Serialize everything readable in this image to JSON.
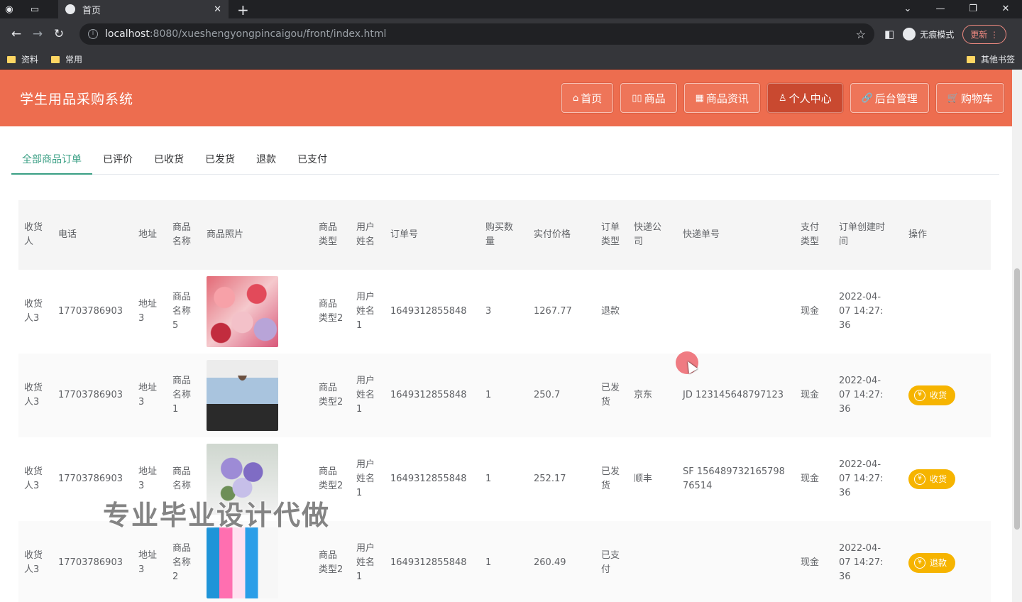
{
  "browser": {
    "tab_title": "首页",
    "url_host": "localhost",
    "url_path": ":8080/xueshengyongpincaigou/front/index.html",
    "incognito_label": "无痕模式",
    "update_label": "更新",
    "bookmarks": [
      "资料",
      "常用"
    ],
    "other_bookmarks": "其他书签"
  },
  "header": {
    "site_title": "学生用品采购系统",
    "nav": [
      {
        "icon": "⌂",
        "label": "首页"
      },
      {
        "icon": "▯▯",
        "label": "商品"
      },
      {
        "icon": "▦",
        "label": "商品资讯"
      },
      {
        "icon": "♙",
        "label": "个人中心"
      },
      {
        "icon": "🔗",
        "label": "后台管理"
      },
      {
        "icon": "🛒",
        "label": "购物车"
      }
    ],
    "active_nav": "个人中心"
  },
  "order_tabs": [
    "全部商品订单",
    "已评价",
    "已收货",
    "已发货",
    "退款",
    "已支付"
  ],
  "active_tab": "全部商品订单",
  "table": {
    "columns": [
      "收货人",
      "电话",
      "地址",
      "商品名称",
      "商品照片",
      "商品类型",
      "用户姓名",
      "订单号",
      "购买数量",
      "实付价格",
      "订单类型",
      "快递公司",
      "快递单号",
      "支付类型",
      "订单创建时间",
      "操作"
    ],
    "rows": [
      {
        "receiver": "收货人3",
        "phone": "17703786903",
        "address": "地址3",
        "product_name": "商品名称5",
        "photo": "roses",
        "product_type": "商品类型2",
        "user_name": "用户姓名1",
        "order_no": "1649312855848",
        "quantity": "3",
        "price": "1267.77",
        "order_type": "退款",
        "courier": "",
        "tracking_no": "",
        "pay_type": "现金",
        "created": "2022-04-07 14:27:36",
        "action": ""
      },
      {
        "receiver": "收货人3",
        "phone": "17703786903",
        "address": "地址3",
        "product_name": "商品名称1",
        "photo": "shirt",
        "product_type": "商品类型2",
        "user_name": "用户姓名1",
        "order_no": "1649312855848",
        "quantity": "1",
        "price": "250.7",
        "order_type": "已发货",
        "courier": "京东",
        "tracking_no": "JD 123145648797123",
        "pay_type": "现金",
        "created": "2022-04-07 14:27:36",
        "action": "收货"
      },
      {
        "receiver": "收货人3",
        "phone": "17703786903",
        "address": "地址3",
        "product_name": "商品名称",
        "photo": "bouquet",
        "product_type": "商品类型2",
        "user_name": "用户姓名1",
        "order_no": "1649312855848",
        "quantity": "1",
        "price": "252.17",
        "order_type": "已发货",
        "courier": "顺丰",
        "tracking_no": "SF 15648973216579876514",
        "pay_type": "现金",
        "created": "2022-04-07 14:27:36",
        "action": "收货"
      },
      {
        "receiver": "收货人3",
        "phone": "17703786903",
        "address": "地址3",
        "product_name": "商品名称2",
        "photo": "supplies",
        "product_type": "商品类型2",
        "user_name": "用户姓名1",
        "order_no": "1649312855848",
        "quantity": "1",
        "price": "260.49",
        "order_type": "已支付",
        "courier": "",
        "tracking_no": "",
        "pay_type": "现金",
        "created": "2022-04-07 14:27:36",
        "action": "退款"
      }
    ]
  },
  "watermark": "专业毕业设计代做",
  "colors": {
    "header_bg": "#ed6d4f",
    "active_tab": "#3a9f84",
    "action_button": "#f6b400"
  }
}
